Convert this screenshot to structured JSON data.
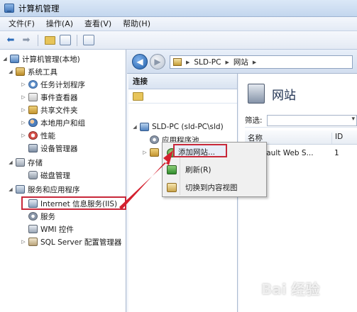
{
  "window": {
    "title": "计算机管理"
  },
  "menu": [
    "文件(F)",
    "操作(A)",
    "查看(V)",
    "帮助(H)"
  ],
  "tree": {
    "root": "计算机管理(本地)",
    "system_tools": "系统工具",
    "task_scheduler": "任务计划程序",
    "event_viewer": "事件查看器",
    "shared_folders": "共享文件夹",
    "local_users": "本地用户和组",
    "performance": "性能",
    "device_manager": "设备管理器",
    "storage": "存储",
    "disk_management": "磁盘管理",
    "services_apps": "服务和应用程序",
    "iis": "Internet 信息服务(IIS)",
    "services": "服务",
    "wmi": "WMI 控件",
    "sql": "SQL Server 配置管理器"
  },
  "address": {
    "host": "SLD-PC",
    "page": "网站"
  },
  "connections": {
    "title": "连接",
    "server": "SLD-PC (sld-PC\\sld)",
    "app_pools": "应用程序池",
    "sites": "网站"
  },
  "sites_pane": {
    "title": "网站",
    "filter_label": "筛选:",
    "col_name": "名称",
    "col_id": "ID",
    "row_name": "Default Web S...",
    "row_id": "1"
  },
  "context_menu": {
    "add_site": "添加网站...",
    "refresh": "刷新(R)",
    "switch_view": "切换到内容视图"
  },
  "watermark": "Bai 经验",
  "colors": {
    "highlight": "#c8283a",
    "accent": "#1f5ea9"
  }
}
